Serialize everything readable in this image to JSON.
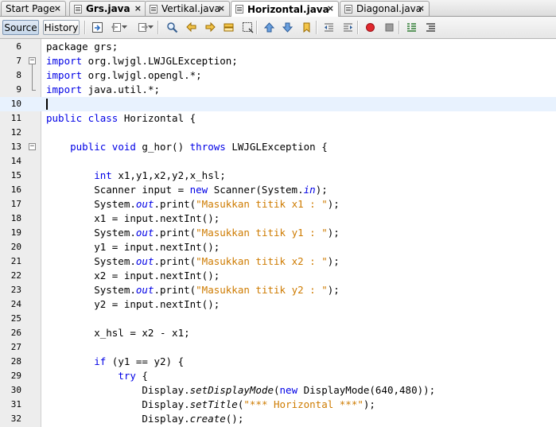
{
  "tabs": [
    {
      "label": "Start Page",
      "icon": "none",
      "close": "×",
      "active": false,
      "bold": false
    },
    {
      "label": "Grs.java",
      "icon": "java-file-icon",
      "close": "×",
      "active": false,
      "bold": true
    },
    {
      "label": "Vertikal.java",
      "icon": "java-file-icon",
      "close": "×",
      "active": false,
      "bold": false
    },
    {
      "label": "Horizontal.java",
      "icon": "java-file-icon",
      "close": "×",
      "active": true,
      "bold": true
    },
    {
      "label": "Diagonal.java",
      "icon": "java-file-icon",
      "close": "×",
      "active": false,
      "bold": false
    }
  ],
  "toolbar": {
    "source_label": "Source",
    "history_label": "History",
    "icons": [
      "last-edit-icon",
      "back-icon",
      "forward-icon",
      "find-icon",
      "find-previous-icon",
      "find-next-icon",
      "toggle-highlight-icon",
      "find-selection-icon",
      "previous-bookmark-icon",
      "next-bookmark-icon",
      "toggle-bookmark-icon",
      "shift-left-icon",
      "shift-right-icon",
      "start-macro-icon",
      "stop-macro-icon",
      "comment-icon",
      "uncomment-icon"
    ]
  },
  "editor": {
    "current_line": 10,
    "lines": [
      {
        "n": "6",
        "tokens": [
          {
            "t": "package grs;"
          }
        ]
      },
      {
        "n": "7",
        "fold": "−",
        "tokens": [
          {
            "t": "import",
            "c": "kw"
          },
          {
            "t": " org.lwjgl.LWJGLException;"
          }
        ]
      },
      {
        "n": "8",
        "tokens": [
          {
            "t": "import",
            "c": "kw"
          },
          {
            "t": " org.lwjgl.opengl.*;"
          }
        ]
      },
      {
        "n": "9",
        "tokens": [
          {
            "t": "import",
            "c": "kw"
          },
          {
            "t": " java.util.*;"
          }
        ]
      },
      {
        "n": "10",
        "tokens": []
      },
      {
        "n": "11",
        "tokens": [
          {
            "t": "public class",
            "c": "kw"
          },
          {
            "t": " Horizontal {"
          }
        ]
      },
      {
        "n": "12",
        "tokens": []
      },
      {
        "n": "13",
        "fold": "−",
        "tokens": [
          {
            "t": "    "
          },
          {
            "t": "public void",
            "c": "kw"
          },
          {
            "t": " g_hor() "
          },
          {
            "t": "throws",
            "c": "kw"
          },
          {
            "t": " LWJGLException {"
          }
        ]
      },
      {
        "n": "14",
        "tokens": []
      },
      {
        "n": "15",
        "tokens": [
          {
            "t": "        "
          },
          {
            "t": "int",
            "c": "kw"
          },
          {
            "t": " x1,y1,x2,y2,x_hsl;"
          }
        ]
      },
      {
        "n": "16",
        "tokens": [
          {
            "t": "        Scanner input = "
          },
          {
            "t": "new",
            "c": "kw"
          },
          {
            "t": " Scanner(System."
          },
          {
            "t": "in",
            "c": "kw it"
          },
          {
            "t": ");"
          }
        ]
      },
      {
        "n": "17",
        "tokens": [
          {
            "t": "        System."
          },
          {
            "t": "out",
            "c": "kw it"
          },
          {
            "t": ".print("
          },
          {
            "t": "\"Masukkan titik x1 : \"",
            "c": "str"
          },
          {
            "t": ");"
          }
        ]
      },
      {
        "n": "18",
        "tokens": [
          {
            "t": "        x1 = input.nextInt();"
          }
        ]
      },
      {
        "n": "19",
        "tokens": [
          {
            "t": "        System."
          },
          {
            "t": "out",
            "c": "kw it"
          },
          {
            "t": ".print("
          },
          {
            "t": "\"Masukkan titik y1 : \"",
            "c": "str"
          },
          {
            "t": ");"
          }
        ]
      },
      {
        "n": "20",
        "tokens": [
          {
            "t": "        y1 = input.nextInt();"
          }
        ]
      },
      {
        "n": "21",
        "tokens": [
          {
            "t": "        System."
          },
          {
            "t": "out",
            "c": "kw it"
          },
          {
            "t": ".print("
          },
          {
            "t": "\"Masukkan titik x2 : \"",
            "c": "str"
          },
          {
            "t": ");"
          }
        ]
      },
      {
        "n": "22",
        "tokens": [
          {
            "t": "        x2 = input.nextInt();"
          }
        ]
      },
      {
        "n": "23",
        "tokens": [
          {
            "t": "        System."
          },
          {
            "t": "out",
            "c": "kw it"
          },
          {
            "t": ".print("
          },
          {
            "t": "\"Masukkan titik y2 : \"",
            "c": "str"
          },
          {
            "t": ");"
          }
        ]
      },
      {
        "n": "24",
        "tokens": [
          {
            "t": "        y2 = input.nextInt();"
          }
        ]
      },
      {
        "n": "25",
        "tokens": []
      },
      {
        "n": "26",
        "tokens": [
          {
            "t": "        x_hsl = x2 - x1;"
          }
        ]
      },
      {
        "n": "27",
        "tokens": []
      },
      {
        "n": "28",
        "tokens": [
          {
            "t": "        "
          },
          {
            "t": "if",
            "c": "kw"
          },
          {
            "t": " (y1 == y2) {"
          }
        ]
      },
      {
        "n": "29",
        "tokens": [
          {
            "t": "            "
          },
          {
            "t": "try",
            "c": "kw"
          },
          {
            "t": " {"
          }
        ]
      },
      {
        "n": "30",
        "tokens": [
          {
            "t": "                Display."
          },
          {
            "t": "setDisplayMode",
            "c": "it"
          },
          {
            "t": "("
          },
          {
            "t": "new",
            "c": "kw"
          },
          {
            "t": " DisplayMode(640,480));"
          }
        ]
      },
      {
        "n": "31",
        "tokens": [
          {
            "t": "                Display."
          },
          {
            "t": "setTitle",
            "c": "it"
          },
          {
            "t": "("
          },
          {
            "t": "\"*** Horizontal ***\"",
            "c": "str"
          },
          {
            "t": ");"
          }
        ]
      },
      {
        "n": "32",
        "tokens": [
          {
            "t": "                Display."
          },
          {
            "t": "create",
            "c": "it"
          },
          {
            "t": "();"
          }
        ]
      }
    ]
  }
}
